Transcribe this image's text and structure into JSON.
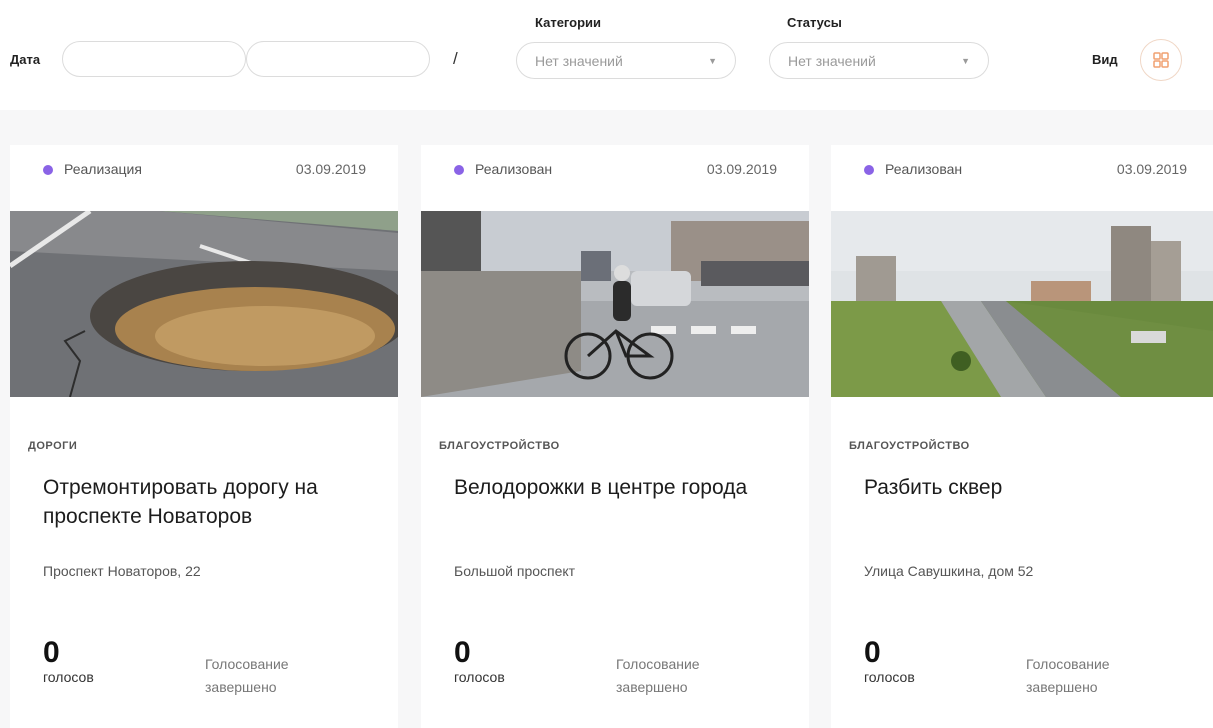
{
  "filters": {
    "date_label": "Дата",
    "separator": "/",
    "category_title": "Категории",
    "category_value": "Нет значений",
    "status_title": "Статусы",
    "status_value": "Нет значений",
    "view_label": "Вид"
  },
  "cards": [
    {
      "status": "Реализация",
      "date": "03.09.2019",
      "category": "ДОРОГИ",
      "title": "Отремонтировать дорогу на проспекте Новаторов",
      "address": "Проспект Новаторов, 22",
      "votes": "0",
      "votes_label": "голосов",
      "vote_status": "Голосование завершено"
    },
    {
      "status": "Реализован",
      "date": "03.09.2019",
      "category": "БЛАГОУСТРОЙСТВО",
      "title": "Велодорожки в центре города",
      "address": "Большой проспект",
      "votes": "0",
      "votes_label": "голосов",
      "vote_status": "Голосование завершено"
    },
    {
      "status": "Реализован",
      "date": "03.09.2019",
      "category": "БЛАГОУСТРОЙСТВО",
      "title": "Разбить сквер",
      "address": "Улица Савушкина, дом 52",
      "votes": "0",
      "votes_label": "голосов",
      "vote_status": "Голосование завершено"
    }
  ],
  "colors": {
    "status_dot": "#8a63e6",
    "view_icon_accent": "#f0a070"
  },
  "icons": {
    "select_arrow": "chevron-down-icon",
    "view_toggle": "grid-icon"
  }
}
